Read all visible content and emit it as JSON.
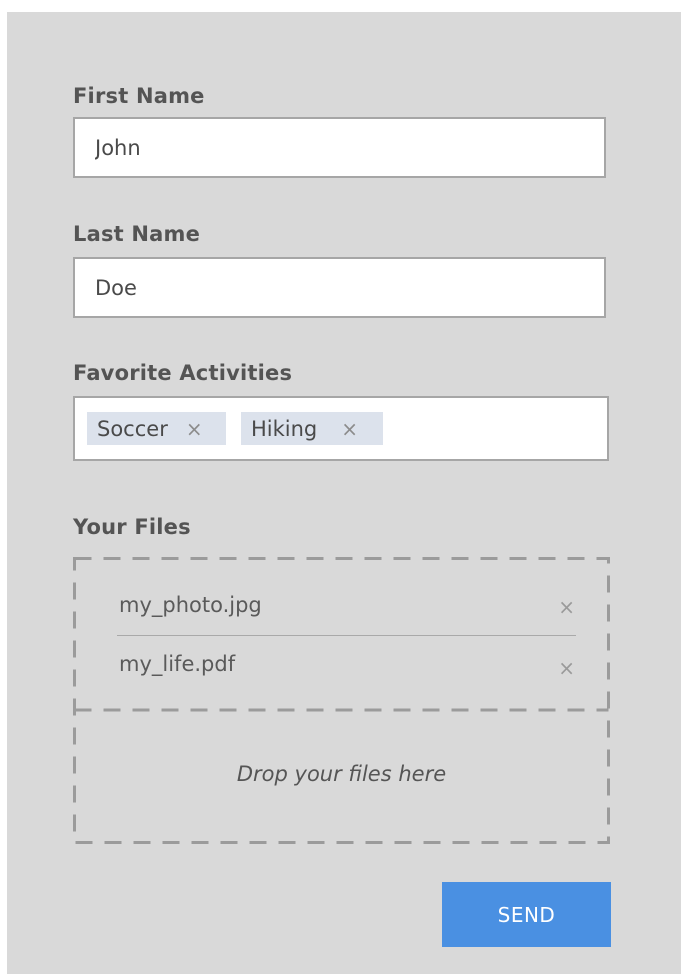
{
  "form": {
    "first_name": {
      "label": "First Name",
      "value": "John"
    },
    "last_name": {
      "label": "Last Name",
      "value": "Doe"
    },
    "activities": {
      "label": "Favorite Activities",
      "tags": [
        {
          "label": "Soccer",
          "remove_icon": "×"
        },
        {
          "label": "Hiking",
          "remove_icon": "×"
        }
      ]
    },
    "files": {
      "label": "Your Files",
      "items": [
        {
          "name": "my_photo.jpg",
          "remove_icon": "×"
        },
        {
          "name": "my_life.pdf",
          "remove_icon": "×"
        }
      ],
      "drop_text": "Drop your files here"
    },
    "send_label": "SEND"
  },
  "colors": {
    "background": "#d9d9d9",
    "tag_bg": "#dce2ec",
    "button": "#4a90e2",
    "dash": "#9b9b9b"
  }
}
